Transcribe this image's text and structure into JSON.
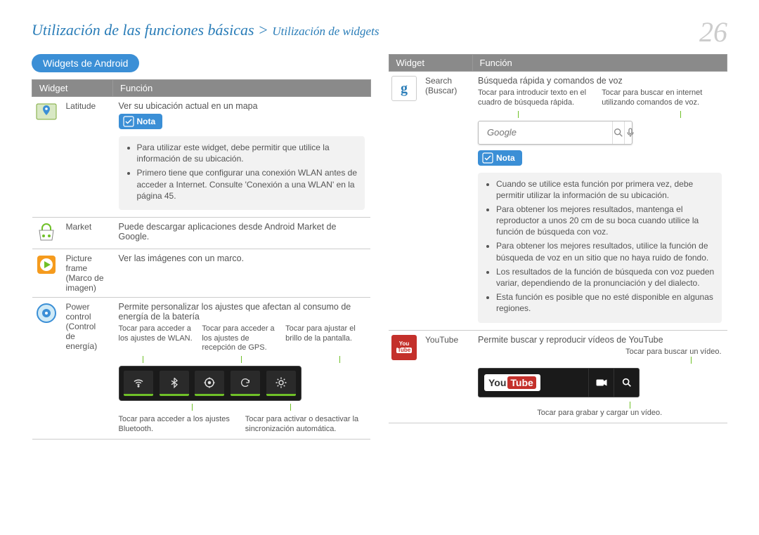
{
  "header": {
    "breadcrumb_main": "Utilización de las funciones básicas",
    "breadcrumb_sep": " > ",
    "breadcrumb_sub": "Utilización de widgets",
    "page_number": "26"
  },
  "section_pill": "Widgets de Android",
  "table_headers": {
    "col1": "Widget",
    "col2": "Función"
  },
  "nota_label": "Nota",
  "left_widgets": {
    "latitude": {
      "name": "Latitude",
      "desc": "Ver su ubicación actual en un mapa",
      "notes": [
        "Para utilizar este widget, debe permitir que utilice la información de su ubicación.",
        "Primero tiene que configurar una conexión WLAN antes de acceder a Internet. Consulte 'Conexión a una WLAN' en la página 45."
      ]
    },
    "market": {
      "name": "Market",
      "desc": "Puede descargar aplicaciones desde Android Market de Google."
    },
    "picture_frame": {
      "name": "Picture frame (Marco de imagen)",
      "desc": "Ver las imágenes con un marco."
    },
    "power": {
      "name": "Power control (Control de energía)",
      "desc": "Permite personalizar los ajustes que afectan al consumo de energía de la batería",
      "top_captions": {
        "c1": "Tocar para acceder a los ajustes de WLAN.",
        "c2": "Tocar para acceder a los ajustes de recepción de GPS.",
        "c3": "Tocar para ajustar el brillo de la pantalla."
      },
      "bottom_captions": {
        "c1": "Tocar para acceder a los ajustes Bluetooth.",
        "c2": "Tocar para activar o desactivar la sincronización automática."
      }
    }
  },
  "right_widgets": {
    "search": {
      "name": "Search (Buscar)",
      "desc": "Búsqueda rápida y comandos de voz",
      "cap_left": "Tocar para introducir texto en el cuadro de búsqueda rápida.",
      "cap_right": "Tocar para buscar en internet utilizando comandos de voz.",
      "placeholder": "Google",
      "notes": [
        "Cuando se utilice esta función por primera vez, debe permitir utilizar la información de su ubicación.",
        "Para obtener los mejores resultados, mantenga el reproductor a unos 20 cm de su boca cuando utilice la función de búsqueda con voz.",
        "Para obtener los mejores resultados, utilice la función de búsqueda de voz en un sitio que no haya ruido de fondo.",
        "Los resultados de la función de búsqueda con voz pueden variar, dependiendo de la pronunciación y del dialecto.",
        "Esta función es posible que no esté disponible en algunas regiones."
      ]
    },
    "youtube": {
      "name": "YouTube",
      "desc": "Permite buscar y reproducir vídeos de YouTube",
      "cap_top": "Tocar para buscar un vídeo.",
      "cap_bottom": "Tocar para grabar y cargar un vídeo."
    }
  }
}
